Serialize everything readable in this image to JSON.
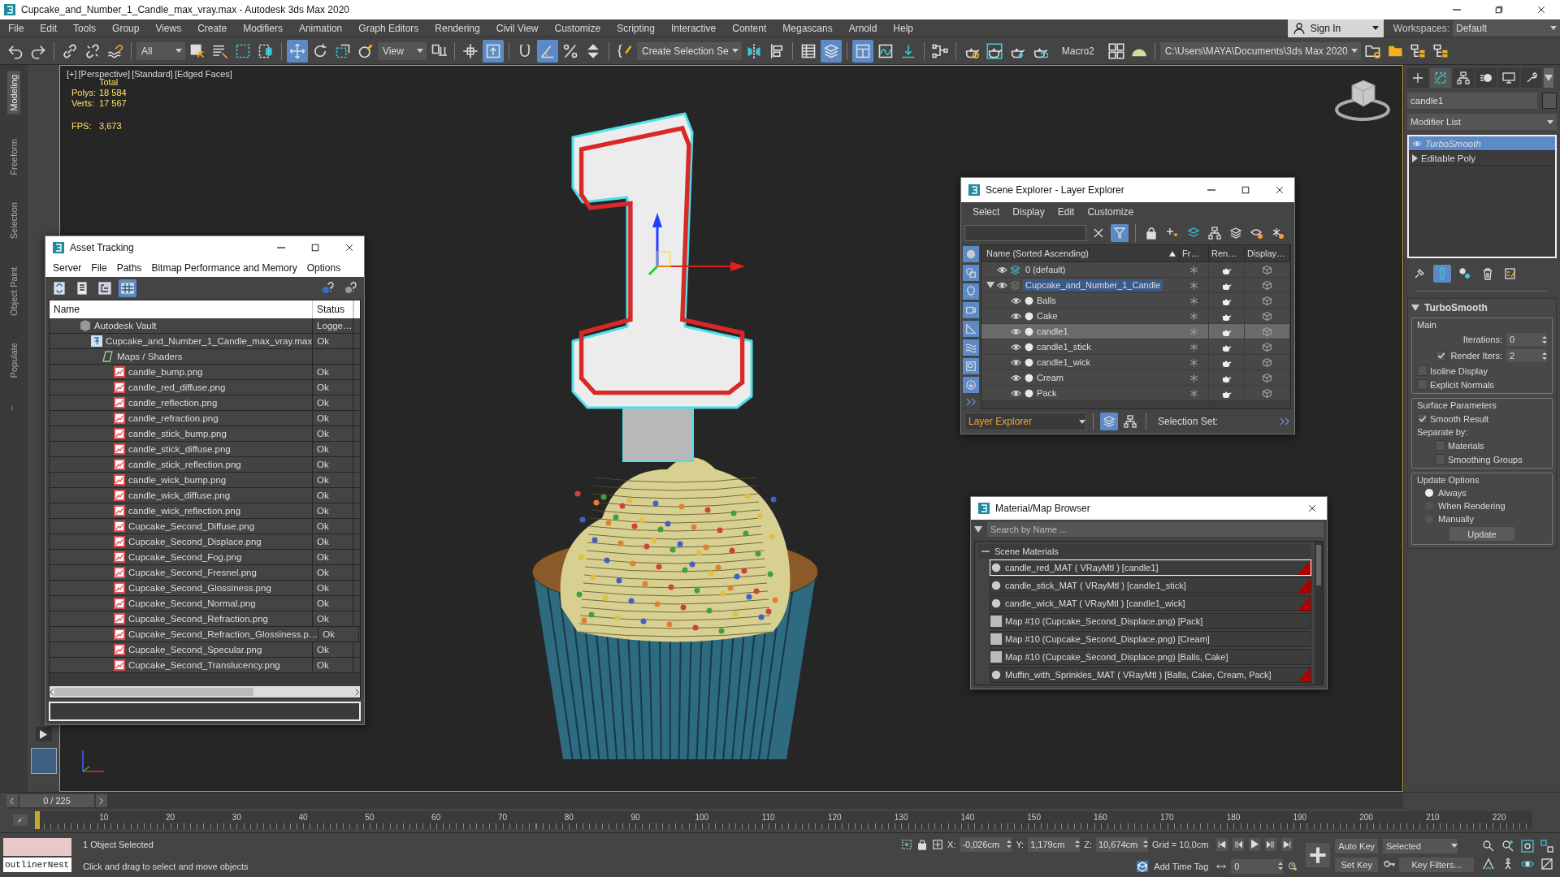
{
  "window": {
    "title": "Cupcake_and_Number_1_Candle_max_vray.max - Autodesk 3ds Max 2020"
  },
  "menu": [
    "File",
    "Edit",
    "Tools",
    "Group",
    "Views",
    "Create",
    "Modifiers",
    "Animation",
    "Graph Editors",
    "Rendering",
    "Civil View",
    "Customize",
    "Scripting",
    "Interactive",
    "Content",
    "Megascans",
    "Arnold",
    "Help"
  ],
  "account": {
    "sign_in": "Sign In",
    "workspaces_label": "Workspaces:",
    "workspace": "Default"
  },
  "toolbar": [
    {
      "kind": "button",
      "on": false
    },
    {
      "kind": "button",
      "on": false
    },
    {
      "kind": "separator"
    },
    {
      "kind": "button",
      "on": false
    },
    {
      "kind": "button",
      "on": false
    },
    {
      "kind": "button",
      "on": false
    },
    {
      "kind": "separator"
    },
    {
      "kind": "dropdown",
      "value": "All"
    },
    {
      "kind": "button",
      "on": false
    },
    {
      "kind": "button",
      "on": false
    },
    {
      "kind": "button",
      "on": false
    },
    {
      "kind": "button",
      "on": false
    },
    {
      "kind": "separator"
    },
    {
      "kind": "button",
      "on": true
    },
    {
      "kind": "button",
      "on": false
    },
    {
      "kind": "button",
      "on": false
    },
    {
      "kind": "button",
      "on": false
    },
    {
      "kind": "dropdown",
      "value": "View"
    },
    {
      "kind": "button",
      "on": false
    },
    {
      "kind": "separator"
    },
    {
      "kind": "button",
      "on": false
    },
    {
      "kind": "button",
      "on": true
    },
    {
      "kind": "separator"
    },
    {
      "kind": "button",
      "on": false
    },
    {
      "kind": "button",
      "on": true
    },
    {
      "kind": "button",
      "on": false
    },
    {
      "kind": "button",
      "on": false
    },
    {
      "kind": "separator"
    },
    {
      "kind": "button",
      "on": false
    },
    {
      "kind": "dropdown",
      "value": "Create Selection Se"
    },
    {
      "kind": "button",
      "on": false
    },
    {
      "kind": "button",
      "on": false
    },
    {
      "kind": "separator"
    },
    {
      "kind": "button",
      "on": false
    },
    {
      "kind": "button",
      "on": true
    },
    {
      "kind": "separator"
    },
    {
      "kind": "button",
      "on": true
    },
    {
      "kind": "button",
      "on": false
    },
    {
      "kind": "button",
      "on": false
    },
    {
      "kind": "separator"
    },
    {
      "kind": "button",
      "on": false
    },
    {
      "kind": "separator"
    },
    {
      "kind": "button",
      "on": false
    },
    {
      "kind": "button",
      "on": false
    },
    {
      "kind": "button",
      "on": false
    },
    {
      "kind": "button",
      "on": false
    },
    {
      "kind": "label",
      "text": "Macro2"
    },
    {
      "kind": "button",
      "on": false
    },
    {
      "kind": "button",
      "on": false
    },
    {
      "kind": "separator"
    },
    {
      "kind": "dropdown",
      "value": "C:\\Users\\MAYA\\Documents\\3ds Max 2020"
    },
    {
      "kind": "button",
      "on": false
    },
    {
      "kind": "button",
      "on": false
    },
    {
      "kind": "button",
      "on": false
    },
    {
      "kind": "button",
      "on": false
    }
  ],
  "side_tabs": [
    {
      "label": "Modeling",
      "selected": true
    },
    {
      "label": "Freeform",
      "selected": false
    },
    {
      "label": "Selection",
      "selected": false
    },
    {
      "label": "Object Paint",
      "selected": false
    },
    {
      "label": "Populate",
      "selected": false
    }
  ],
  "viewport": {
    "labels": [
      "[+]",
      "[Perspective]",
      "[Standard]",
      "[Edged Faces]"
    ],
    "stats": {
      "total": "Total",
      "rows": [
        {
          "label": "Polys:",
          "value": "18 584"
        },
        {
          "label": "Verts:",
          "value": "17 567"
        }
      ],
      "fps_label": "FPS:",
      "fps": "3,673"
    }
  },
  "asset_tracking": {
    "title": "Asset Tracking",
    "menu": [
      "Server",
      "File",
      "Paths",
      "Bitmap Performance and Memory",
      "Options"
    ],
    "views": [
      {
        "selected": false
      },
      {
        "selected": false
      },
      {
        "selected": false
      },
      {
        "selected": true
      }
    ],
    "columns": [
      "Name",
      "Status"
    ],
    "tree": [
      {
        "kind": "vault",
        "name": "Autodesk Vault",
        "status": "Logge…",
        "children": [
          {
            "kind": "scene",
            "name": "Cupcake_and_Number_1_Candle_max_vray.max",
            "status": "Ok",
            "children": [
              {
                "kind": "folder",
                "name": "Maps / Shaders",
                "children": [
                  {
                    "kind": "bitmap",
                    "name": "candle_bump.png",
                    "status": "Ok"
                  },
                  {
                    "kind": "bitmap",
                    "name": "candle_red_diffuse.png",
                    "status": "Ok"
                  },
                  {
                    "kind": "bitmap",
                    "name": "candle_reflection.png",
                    "status": "Ok"
                  },
                  {
                    "kind": "bitmap",
                    "name": "candle_refraction.png",
                    "status": "Ok"
                  },
                  {
                    "kind": "bitmap",
                    "name": "candle_stick_bump.png",
                    "status": "Ok"
                  },
                  {
                    "kind": "bitmap",
                    "name": "candle_stick_diffuse.png",
                    "status": "Ok"
                  },
                  {
                    "kind": "bitmap",
                    "name": "candle_stick_reflection.png",
                    "status": "Ok"
                  },
                  {
                    "kind": "bitmap",
                    "name": "candle_wick_bump.png",
                    "status": "Ok"
                  },
                  {
                    "kind": "bitmap",
                    "name": "candle_wick_diffuse.png",
                    "status": "Ok"
                  },
                  {
                    "kind": "bitmap",
                    "name": "candle_wick_reflection.png",
                    "status": "Ok"
                  },
                  {
                    "kind": "bitmap",
                    "name": "Cupcake_Second_Diffuse.png",
                    "status": "Ok"
                  },
                  {
                    "kind": "bitmap",
                    "name": "Cupcake_Second_Displace.png",
                    "status": "Ok"
                  },
                  {
                    "kind": "bitmap",
                    "name": "Cupcake_Second_Fog.png",
                    "status": "Ok"
                  },
                  {
                    "kind": "bitmap",
                    "name": "Cupcake_Second_Fresnel.png",
                    "status": "Ok"
                  },
                  {
                    "kind": "bitmap",
                    "name": "Cupcake_Second_Glossiness.png",
                    "status": "Ok"
                  },
                  {
                    "kind": "bitmap",
                    "name": "Cupcake_Second_Normal.png",
                    "status": "Ok"
                  },
                  {
                    "kind": "bitmap",
                    "name": "Cupcake_Second_Refraction.png",
                    "status": "Ok"
                  },
                  {
                    "kind": "bitmap",
                    "name": "Cupcake_Second_Refraction_Glossiness.p…",
                    "status": "Ok"
                  },
                  {
                    "kind": "bitmap",
                    "name": "Cupcake_Second_Specular.png",
                    "status": "Ok"
                  },
                  {
                    "kind": "bitmap",
                    "name": "Cupcake_Second_Translucency.png",
                    "status": "Ok"
                  }
                ]
              }
            ]
          }
        ]
      }
    ]
  },
  "scene_explorer": {
    "title": "Scene Explorer - Layer Explorer",
    "menu": [
      "Select",
      "Display",
      "Edit",
      "Customize"
    ],
    "filter_on": true,
    "display_filters": [
      {
        "on": true
      },
      {
        "on": true
      },
      {
        "on": true
      },
      {
        "on": true
      },
      {
        "on": true
      },
      {
        "on": true
      },
      {
        "on": true
      },
      {
        "on": true
      }
    ],
    "columns": [
      "Name (Sorted Ascending)",
      "Fr…",
      "Ren…",
      "Display…"
    ],
    "layers": [
      {
        "kind": "layer",
        "name": "0 (default)",
        "active": true,
        "selected": false
      },
      {
        "kind": "layer",
        "name": "Cupcake_and_Number_1_Candle",
        "active": false,
        "selected": true,
        "expanded": true,
        "children": [
          {
            "kind": "object",
            "name": "Balls",
            "selected": false
          },
          {
            "kind": "object",
            "name": "Cake",
            "selected": false
          },
          {
            "kind": "object",
            "name": "candle1",
            "selected": true
          },
          {
            "kind": "object",
            "name": "candle1_stick",
            "selected": false
          },
          {
            "kind": "object",
            "name": "candle1_wick",
            "selected": false
          },
          {
            "kind": "object",
            "name": "Cream",
            "selected": false
          },
          {
            "kind": "object",
            "name": "Pack",
            "selected": false
          }
        ]
      }
    ],
    "explorer_type": "Layer Explorer",
    "selection_set_label": "Selection Set:"
  },
  "material_browser": {
    "title": "Material/Map Browser",
    "search": {
      "placeholder": "Search by Name ..."
    },
    "group": {
      "label": "Scene Materials",
      "expanded": true,
      "items": [
        {
          "kind": "material",
          "label": "candle_red_MAT ( VRayMtl ) [candle1]",
          "selected": true
        },
        {
          "kind": "material",
          "label": "candle_stick_MAT ( VRayMtl ) [candle1_stick]",
          "selected": false
        },
        {
          "kind": "material",
          "label": "candle_wick_MAT ( VRayMtl ) [candle1_wick]",
          "selected": false
        },
        {
          "kind": "map",
          "label": "Map #10 (Cupcake_Second_Displace.png) [Pack]",
          "selected": false
        },
        {
          "kind": "map",
          "label": "Map #10 (Cupcake_Second_Displace.png) [Cream]",
          "selected": false
        },
        {
          "kind": "map",
          "label": "Map #10 (Cupcake_Second_Displace.png) [Balls, Cake]",
          "selected": false
        },
        {
          "kind": "material",
          "label": "Muffin_with_Sprinkles_MAT ( VRayMtl ) [Balls, Cake, Cream, Pack]",
          "selected": false
        }
      ]
    }
  },
  "command_panel": {
    "tabs": [
      {
        "selected": false
      },
      {
        "selected": true
      },
      {
        "selected": false
      },
      {
        "selected": false
      },
      {
        "selected": false
      },
      {
        "selected": false
      }
    ],
    "object_name": "candle1",
    "modifier_list": "Modifier List",
    "stack": [
      {
        "kind": "modifier",
        "name": "TurboSmooth",
        "selected": true
      },
      {
        "kind": "base",
        "name": "Editable Poly",
        "selected": false
      }
    ],
    "rollout": {
      "title": "TurboSmooth",
      "main": {
        "label": "Main",
        "iterations_label": "Iterations:",
        "iterations": "0",
        "render_iters_label": "Render Iters:",
        "render_iters": "2",
        "render_iters_checked": true,
        "checks": [
          {
            "label": "Isoline Display",
            "checked": false
          },
          {
            "label": "Explicit Normals",
            "checked": false
          }
        ]
      },
      "surface": {
        "label": "Surface Parameters",
        "smooth_result": {
          "label": "Smooth Result",
          "checked": true
        },
        "separate_label": "Separate by:",
        "checks": [
          {
            "label": "Materials",
            "checked": false
          },
          {
            "label": "Smoothing Groups",
            "checked": false
          }
        ]
      },
      "update": {
        "label": "Update Options",
        "options": [
          {
            "label": "Always",
            "selected": true
          },
          {
            "label": "When Rendering",
            "selected": false
          },
          {
            "label": "Manually",
            "selected": false
          }
        ],
        "button": "Update"
      }
    }
  },
  "timeline": {
    "frame": "0 / 225",
    "level": 0,
    "labels": [
      "10",
      "20",
      "30",
      "40",
      "50",
      "60",
      "70",
      "80",
      "90",
      "100",
      "110",
      "120",
      "130",
      "140",
      "150",
      "160",
      "170",
      "180",
      "190",
      "200",
      "210",
      "220"
    ]
  },
  "status": {
    "listener": "outlinerNest",
    "selection": "1 Object Selected",
    "prompt": "Click and drag to select and move objects",
    "x_label": "X:",
    "x": "-0,026cm",
    "y_label": "Y:",
    "y": "1,179cm",
    "z_label": "Z:",
    "z": "10,674cm",
    "grid": "Grid = 10,0cm",
    "time_tag": "Add Time Tag",
    "frame": "0",
    "auto_key": "Auto Key",
    "key_mode": "Selected",
    "set_key": "Set Key",
    "key_filters": "Key Filters..."
  }
}
